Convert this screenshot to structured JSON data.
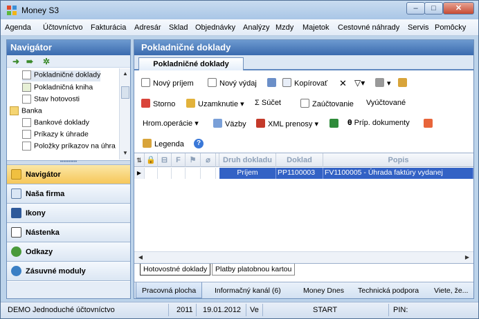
{
  "window": {
    "title": "Money S3",
    "min_label": "–",
    "max_label": "□",
    "close_label": "✕"
  },
  "menu": [
    "Agenda",
    "Účtovníctvo",
    "Fakturácia",
    "Adresár",
    "Sklad",
    "Objednávky",
    "Analýzy",
    "Mzdy",
    "Majetok",
    "Cestovné náhrady",
    "Servis",
    "Pomôcky"
  ],
  "navigator": {
    "title": "Navigátor",
    "tree": [
      "Pokladničné doklady",
      "Pokladničná kniha",
      "Stav hotovosti",
      "Banka",
      "Bankové doklady",
      "Príkazy k úhrade",
      "Položky príkazov na úhra"
    ],
    "buttons": [
      "Navigátor",
      "Naša firma",
      "Ikony",
      "Nástenka",
      "Odkazy",
      "Zásuvné moduly"
    ]
  },
  "main": {
    "title": "Pokladničné doklady",
    "tab": "Pokladničné doklady",
    "toolbar1": [
      "Nový príjem",
      "Nový výdaj",
      "Kopírovať"
    ],
    "toolbar2": [
      "Storno",
      "Uzamknutie",
      "Súčet",
      "Zaúčtovanie",
      "Vyúčtované"
    ],
    "toolbar3": [
      "Hrom.operácie",
      "Väzby",
      "XML prenosy",
      "Príp. dokumenty"
    ],
    "legend": "Legenda",
    "columns": [
      "Druh dokladu",
      "Doklad",
      "Popis"
    ],
    "rows": [
      {
        "druh": "Príjem",
        "doklad": "PP1100003",
        "popis": "FV1100005 - Úhrada faktúry vydanej"
      }
    ],
    "bottom_tabs": [
      "Hotovostné doklady",
      "Platby platobnou kartou"
    ],
    "work_tabs": [
      "Pracovná plocha",
      "Informačný kanál (6)",
      "Money Dnes",
      "Technická podpora",
      "Viete, že..."
    ]
  },
  "status": {
    "company": "DEMO Jednoduché účtovníctvo",
    "year": "2011",
    "date": "19.01.2012",
    "ve": "Ve",
    "start": "START",
    "pin": "PIN:"
  }
}
